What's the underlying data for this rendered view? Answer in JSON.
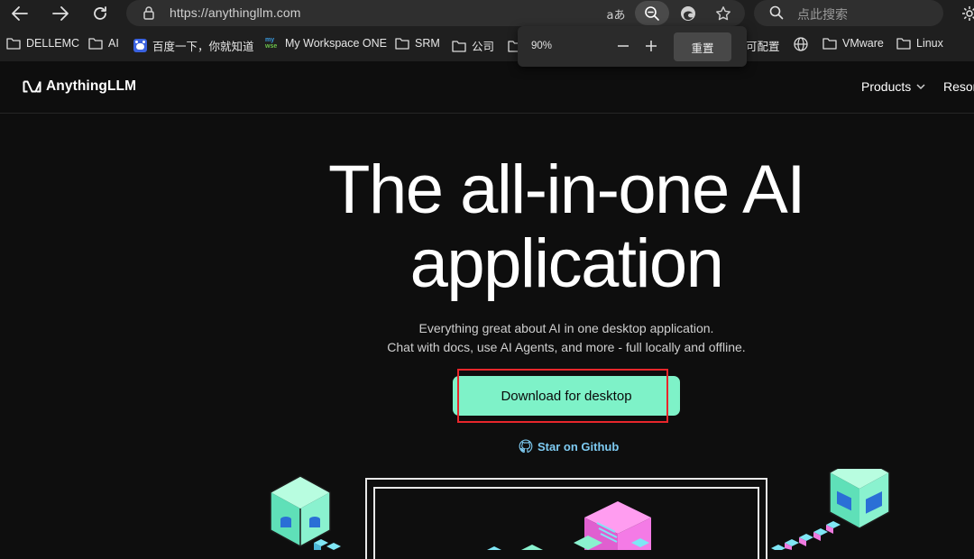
{
  "browser": {
    "url": "https://anythingllm.com",
    "search_placeholder": "点此搜索",
    "bookmarks": [
      {
        "label": "DELLEMC",
        "icon": "folder-icon"
      },
      {
        "label": "AI",
        "icon": "folder-icon"
      },
      {
        "label": "百度一下，你就知道",
        "icon": "baidu-icon"
      },
      {
        "label": "My Workspace ONE",
        "icon": "workspace-one-icon"
      },
      {
        "label": "SRM",
        "icon": "folder-icon"
      },
      {
        "label": "公司",
        "icon": "folder-icon"
      },
      {
        "label": "可配置",
        "icon": "folder-icon"
      },
      {
        "label": "",
        "icon": "globe-icon"
      },
      {
        "label": "VMware",
        "icon": "folder-icon"
      },
      {
        "label": "Linux",
        "icon": "folder-icon"
      }
    ],
    "zoom_popup": {
      "level": "90%",
      "reset_label": "重置"
    }
  },
  "site": {
    "logo_text": "AnythingLLM",
    "nav": {
      "products": "Products",
      "resources": "Resor"
    },
    "hero": {
      "title_line1": "The all-in-one AI",
      "title_line2": "application",
      "subtitle_line1": "Everything great about AI in one desktop application.",
      "subtitle_line2": "Chat with docs, use AI Agents, and more - full locally and offline.",
      "cta_label": "Download for desktop",
      "github_label": "Star on Github"
    },
    "accent_color": "#7ef2c8",
    "annotation_color": "#e8262b"
  }
}
